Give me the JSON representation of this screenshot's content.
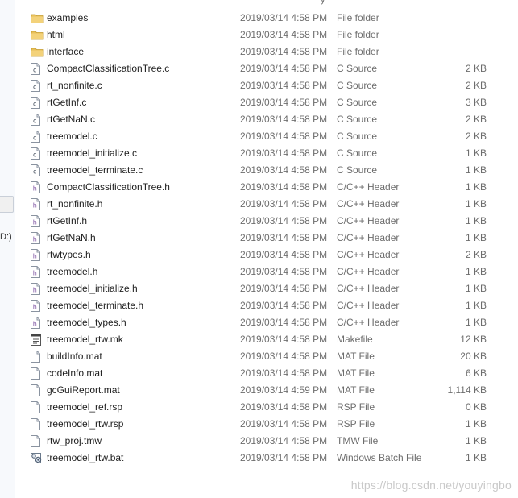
{
  "header_fragment": "y",
  "left_pane": {
    "fragment": "D:)"
  },
  "files": [
    {
      "name": "examples",
      "date": "2019/03/14 4:58 PM",
      "type": "File folder",
      "size": "",
      "icon": "folder-icon"
    },
    {
      "name": "html",
      "date": "2019/03/14 4:58 PM",
      "type": "File folder",
      "size": "",
      "icon": "folder-icon"
    },
    {
      "name": "interface",
      "date": "2019/03/14 4:58 PM",
      "type": "File folder",
      "size": "",
      "icon": "folder-icon"
    },
    {
      "name": "CompactClassificationTree.c",
      "date": "2019/03/14 4:58 PM",
      "type": "C Source",
      "size": "2 KB",
      "icon": "c-source-icon"
    },
    {
      "name": "rt_nonfinite.c",
      "date": "2019/03/14 4:58 PM",
      "type": "C Source",
      "size": "2 KB",
      "icon": "c-source-icon"
    },
    {
      "name": "rtGetInf.c",
      "date": "2019/03/14 4:58 PM",
      "type": "C Source",
      "size": "3 KB",
      "icon": "c-source-icon"
    },
    {
      "name": "rtGetNaN.c",
      "date": "2019/03/14 4:58 PM",
      "type": "C Source",
      "size": "2 KB",
      "icon": "c-source-icon"
    },
    {
      "name": "treemodel.c",
      "date": "2019/03/14 4:58 PM",
      "type": "C Source",
      "size": "2 KB",
      "icon": "c-source-icon"
    },
    {
      "name": "treemodel_initialize.c",
      "date": "2019/03/14 4:58 PM",
      "type": "C Source",
      "size": "1 KB",
      "icon": "c-source-icon"
    },
    {
      "name": "treemodel_terminate.c",
      "date": "2019/03/14 4:58 PM",
      "type": "C Source",
      "size": "1 KB",
      "icon": "c-source-icon"
    },
    {
      "name": "CompactClassificationTree.h",
      "date": "2019/03/14 4:58 PM",
      "type": "C/C++ Header",
      "size": "1 KB",
      "icon": "header-file-icon"
    },
    {
      "name": "rt_nonfinite.h",
      "date": "2019/03/14 4:58 PM",
      "type": "C/C++ Header",
      "size": "1 KB",
      "icon": "header-file-icon"
    },
    {
      "name": "rtGetInf.h",
      "date": "2019/03/14 4:58 PM",
      "type": "C/C++ Header",
      "size": "1 KB",
      "icon": "header-file-icon"
    },
    {
      "name": "rtGetNaN.h",
      "date": "2019/03/14 4:58 PM",
      "type": "C/C++ Header",
      "size": "1 KB",
      "icon": "header-file-icon"
    },
    {
      "name": "rtwtypes.h",
      "date": "2019/03/14 4:58 PM",
      "type": "C/C++ Header",
      "size": "2 KB",
      "icon": "header-file-icon"
    },
    {
      "name": "treemodel.h",
      "date": "2019/03/14 4:58 PM",
      "type": "C/C++ Header",
      "size": "1 KB",
      "icon": "header-file-icon"
    },
    {
      "name": "treemodel_initialize.h",
      "date": "2019/03/14 4:58 PM",
      "type": "C/C++ Header",
      "size": "1 KB",
      "icon": "header-file-icon"
    },
    {
      "name": "treemodel_terminate.h",
      "date": "2019/03/14 4:58 PM",
      "type": "C/C++ Header",
      "size": "1 KB",
      "icon": "header-file-icon"
    },
    {
      "name": "treemodel_types.h",
      "date": "2019/03/14 4:58 PM",
      "type": "C/C++ Header",
      "size": "1 KB",
      "icon": "header-file-icon"
    },
    {
      "name": "treemodel_rtw.mk",
      "date": "2019/03/14 4:58 PM",
      "type": "Makefile",
      "size": "12 KB",
      "icon": "makefile-icon"
    },
    {
      "name": "buildInfo.mat",
      "date": "2019/03/14 4:58 PM",
      "type": "MAT File",
      "size": "20 KB",
      "icon": "blank-file-icon"
    },
    {
      "name": "codeInfo.mat",
      "date": "2019/03/14 4:58 PM",
      "type": "MAT File",
      "size": "6 KB",
      "icon": "blank-file-icon"
    },
    {
      "name": "gcGuiReport.mat",
      "date": "2019/03/14 4:59 PM",
      "type": "MAT File",
      "size": "1,114 KB",
      "icon": "blank-file-icon"
    },
    {
      "name": "treemodel_ref.rsp",
      "date": "2019/03/14 4:58 PM",
      "type": "RSP File",
      "size": "0 KB",
      "icon": "blank-file-icon"
    },
    {
      "name": "treemodel_rtw.rsp",
      "date": "2019/03/14 4:58 PM",
      "type": "RSP File",
      "size": "1 KB",
      "icon": "blank-file-icon"
    },
    {
      "name": "rtw_proj.tmw",
      "date": "2019/03/14 4:58 PM",
      "type": "TMW File",
      "size": "1 KB",
      "icon": "blank-file-icon"
    },
    {
      "name": "treemodel_rtw.bat",
      "date": "2019/03/14 4:58 PM",
      "type": "Windows Batch File",
      "size": "1 KB",
      "icon": "batch-file-icon"
    }
  ],
  "watermark": "https://blog.csdn.net/youyingbo",
  "colors": {
    "folder": "#e8c05a",
    "c_source": "#5f6b7a",
    "header": "#7a4fa0",
    "text": "#1e1e1e",
    "meta": "#6d6d6d"
  }
}
